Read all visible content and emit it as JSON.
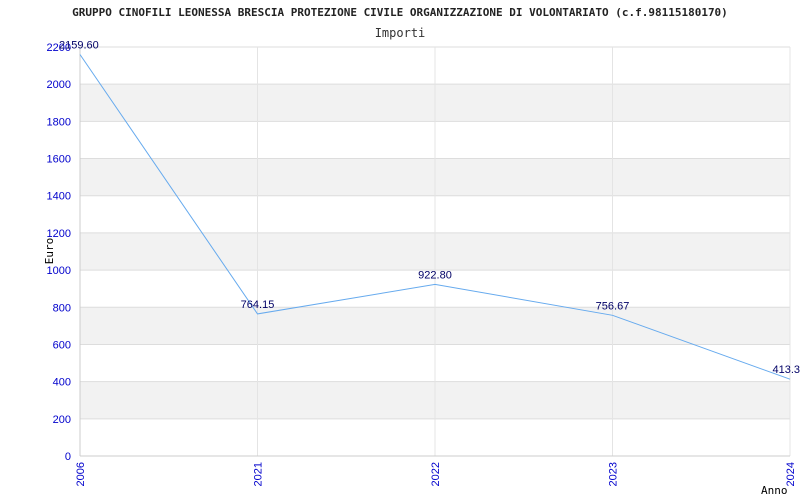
{
  "chart_data": {
    "type": "line",
    "title": "GRUPPO CINOFILI LEONESSA BRESCIA PROTEZIONE CIVILE ORGANIZZAZIONE DI VOLONTARIATO (c.f.98115180170)",
    "subtitle": "Importi",
    "xlabel": "Anno",
    "ylabel": "Euro",
    "categories": [
      "2006",
      "2021",
      "2022",
      "2023",
      "2024"
    ],
    "values": [
      2159.6,
      764.15,
      922.8,
      756.67,
      413.3
    ],
    "value_labels": [
      "2159.60",
      "764.15",
      "922.80",
      "756.67",
      "413.3"
    ],
    "ylim": [
      0,
      2200
    ],
    "yticks": [
      "0",
      "200",
      "400",
      "600",
      "800",
      "1000",
      "1200",
      "1400",
      "1600",
      "1800",
      "2000",
      "2200"
    ],
    "grid": true,
    "line_color": "#66aaee",
    "band_color": "#f2f2f2",
    "tick_color": "#0000cc",
    "label_color": "#000066"
  }
}
